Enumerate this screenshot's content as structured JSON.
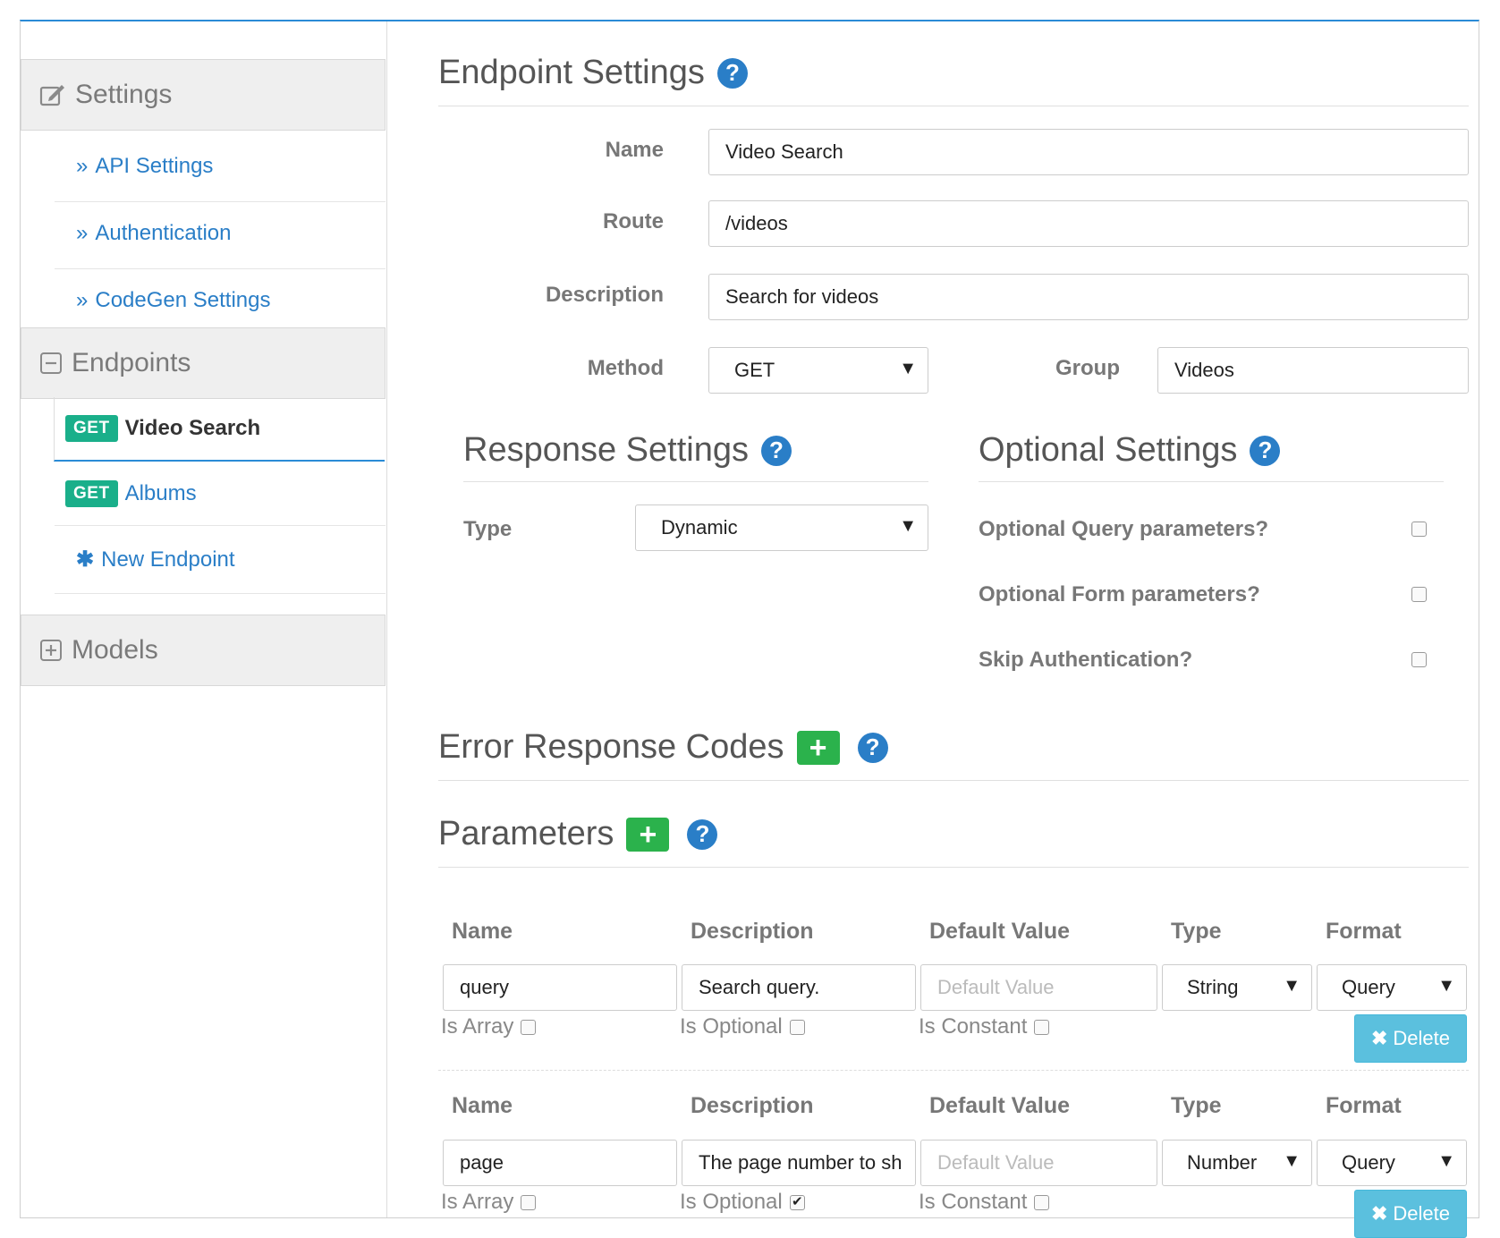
{
  "sidebar": {
    "settings": {
      "label": "Settings"
    },
    "settings_items": [
      "API Settings",
      "Authentication",
      "CodeGen Settings"
    ],
    "endpoints": {
      "label": "Endpoints"
    },
    "endpoint_items": [
      {
        "method": "GET",
        "label": "Video Search"
      },
      {
        "method": "GET",
        "label": "Albums"
      }
    ],
    "new_endpoint": "New Endpoint",
    "models": {
      "label": "Models"
    }
  },
  "endpoint_settings": {
    "title": "Endpoint Settings",
    "name_label": "Name",
    "name_value": "Video Search",
    "route_label": "Route",
    "route_value": "/videos",
    "description_label": "Description",
    "description_value": "Search for videos",
    "method_label": "Method",
    "method_value": "GET",
    "group_label": "Group",
    "group_value": "Videos"
  },
  "response_settings": {
    "title": "Response Settings",
    "type_label": "Type",
    "type_value": "Dynamic"
  },
  "optional_settings": {
    "title": "Optional Settings",
    "items": [
      {
        "label": "Optional Query parameters?",
        "checked": false
      },
      {
        "label": "Optional Form parameters?",
        "checked": false
      },
      {
        "label": "Skip Authentication?",
        "checked": false
      }
    ]
  },
  "error_codes": {
    "title": "Error Response Codes"
  },
  "parameters": {
    "title": "Parameters",
    "headers": [
      "Name",
      "Description",
      "Default Value",
      "Type",
      "Format"
    ],
    "default_placeholder": "Default Value",
    "is_array_label": "Is Array",
    "is_optional_label": "Is Optional",
    "is_constant_label": "Is Constant",
    "delete_label": "Delete",
    "rows": [
      {
        "name": "query",
        "description": "Search query.",
        "type": "String",
        "format": "Query",
        "is_array": false,
        "is_optional": false,
        "is_constant": false
      },
      {
        "name": "page",
        "description": "The page number to sh",
        "type": "Number",
        "format": "Query",
        "is_array": false,
        "is_optional": true,
        "is_constant": false
      }
    ]
  }
}
